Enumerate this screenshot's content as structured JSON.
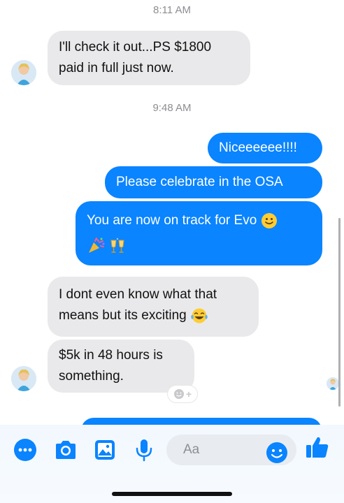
{
  "conversation": {
    "timestamp_1": "8:11 AM",
    "timestamp_2": "9:48 AM",
    "messages": [
      {
        "line1": "I'll check it out...PS $1800",
        "line2": "paid in full just now."
      },
      {
        "text": "Niceeeeee!!!!"
      },
      {
        "text": "Please celebrate in the OSA"
      },
      {
        "text": "You are now on track for Evo"
      },
      {
        "line1": "I dont even know what that",
        "line2": "means but its exciting"
      },
      {
        "line1": "$5k in 48 hours is",
        "line2": "something."
      }
    ]
  },
  "reaction_button": {
    "plus": "+"
  },
  "composer": {
    "placeholder": "Aa",
    "icons": [
      "more-icon",
      "camera-icon",
      "gallery-icon",
      "microphone-icon",
      "emoji-icon",
      "thumbs-up-icon"
    ]
  },
  "colors": {
    "outgoing": "#0a84ff",
    "incoming": "#e9e9eb",
    "timestamp": "#8e8e93",
    "toolbar_icon": "#0a84ff"
  }
}
